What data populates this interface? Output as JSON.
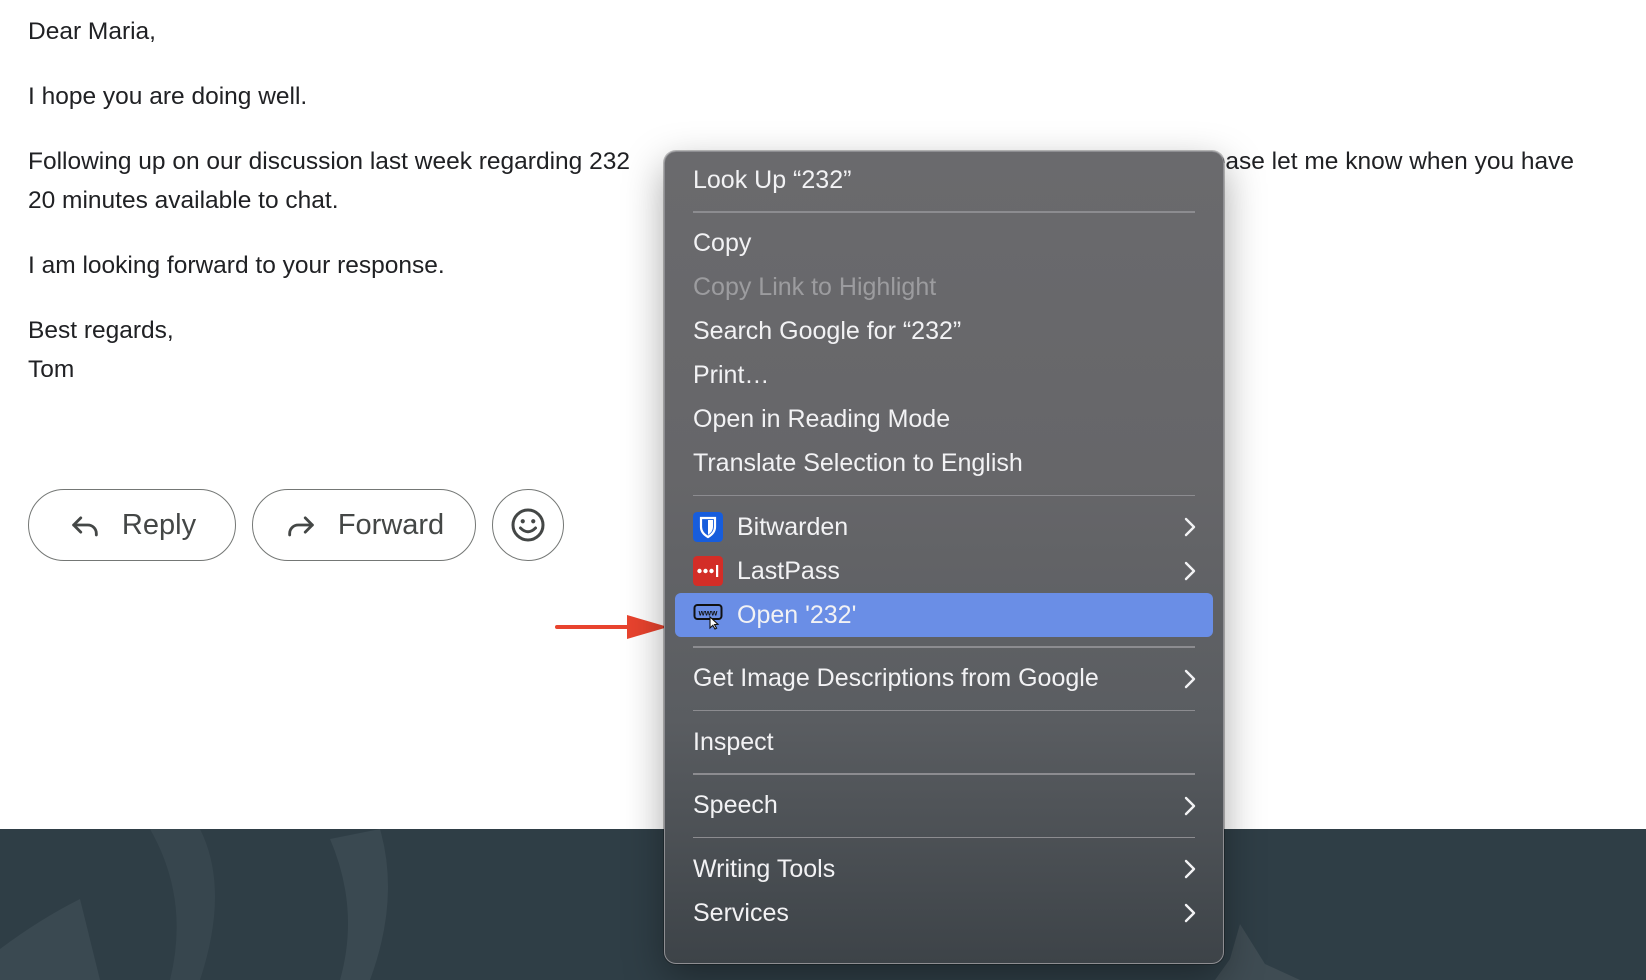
{
  "email": {
    "greeting": "Dear Maria,",
    "line1": "I hope you are doing well.",
    "line2_part1": "Following up on our discussion last week regarding 232",
    "line2_part2": "Please let me know when you have",
    "line2_part3": "20 minutes available to chat.",
    "line3": "I am looking forward to your response.",
    "closing": "Best regards,",
    "signature": "Tom"
  },
  "actions": {
    "reply_label": "Reply",
    "forward_label": "Forward",
    "reply_icon": "reply-arrow-icon",
    "forward_icon": "forward-arrow-icon",
    "emoji_icon": "smiley-face-icon"
  },
  "context_menu": {
    "look_up": "Look Up “232”",
    "copy": "Copy",
    "copy_link": "Copy Link to Highlight",
    "search_google": "Search Google for “232”",
    "print": "Print…",
    "reading_mode": "Open in Reading Mode",
    "translate": "Translate Selection to English",
    "bitwarden": "Bitwarden",
    "lastpass": "LastPass",
    "open_232": "Open '232'",
    "image_descriptions": "Get Image Descriptions from Google",
    "inspect": "Inspect",
    "speech": "Speech",
    "writing_tools": "Writing Tools",
    "services": "Services"
  },
  "colors": {
    "menu_highlight": "#6a8ee6",
    "annotation_arrow": "#e8432e",
    "footer_band": "#2f3e46",
    "bitwarden_brand": "#175ddc",
    "lastpass_brand": "#d32d27"
  }
}
